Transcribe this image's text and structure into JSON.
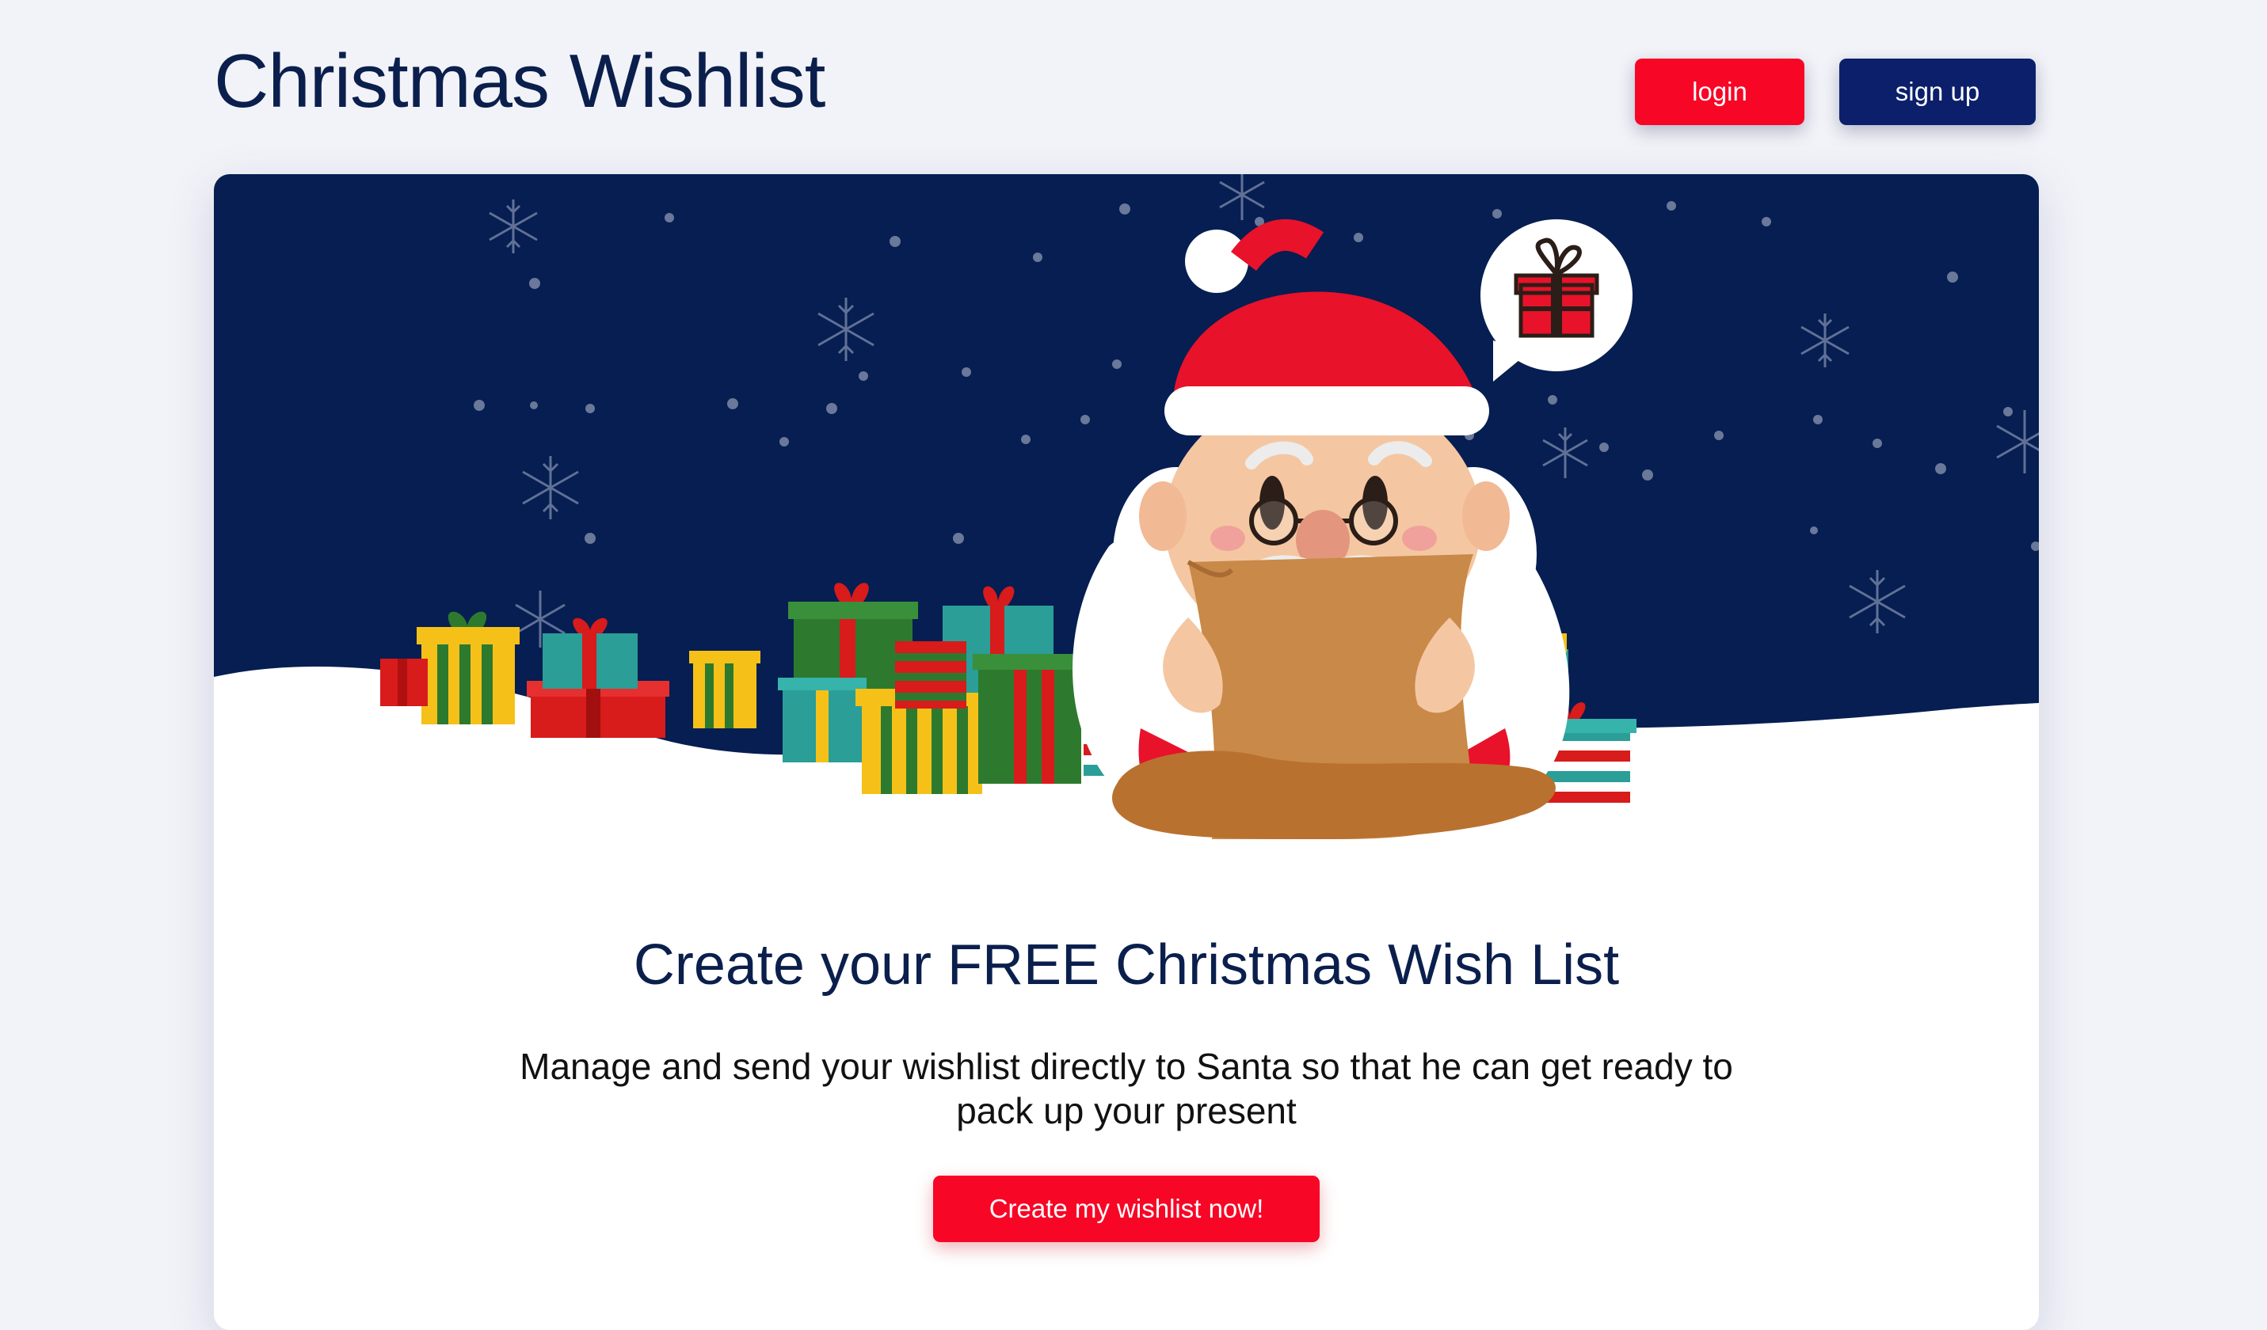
{
  "header": {
    "title": "Christmas Wishlist",
    "login_label": "login",
    "signup_label": "sign up"
  },
  "hero": {
    "illustration": "santa-reading-wishlist",
    "sky_color": "#061e51",
    "speech_bubble_icon": "gift-icon"
  },
  "main": {
    "headline": "Create your FREE Christmas Wish List",
    "description": "Manage and send your wishlist directly to Santa so that he can get ready to pack up your present",
    "cta_label": "Create my wishlist now!"
  },
  "colors": {
    "primary_red": "#f80626",
    "navy": "#0b1f6b",
    "title_navy": "#0b1f4d",
    "page_bg": "#f2f3f8"
  }
}
